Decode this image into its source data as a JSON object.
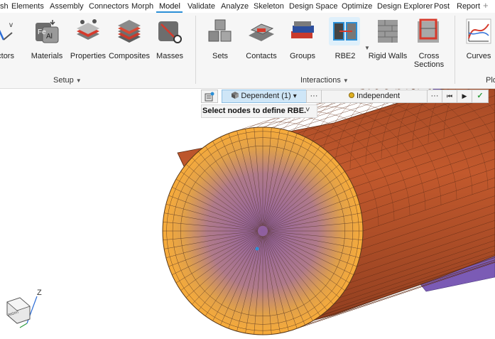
{
  "menu": {
    "items": [
      "sh",
      "Elements",
      "Assembly",
      "Connectors",
      "Morph",
      "Model",
      "Validate",
      "Analyze",
      "Skeleton",
      "Design Space",
      "Optimize",
      "Design Explorer",
      "Post",
      "Report"
    ],
    "active": "Model",
    "plus_glyph": "+"
  },
  "ribbon": {
    "setup_tools": [
      "ectors",
      "Materials",
      "Properties",
      "Composites",
      "Masses"
    ],
    "interaction_tools": [
      "Sets",
      "Contacts",
      "Groups",
      "RBE2",
      "Rigid Walls"
    ],
    "cross_sections": {
      "line1": "Cross",
      "line2": "Sections"
    },
    "curves": "Curves",
    "setup_label": "Setup",
    "interactions_label": "Interactions",
    "plot_label": "Plo",
    "caret": "▼",
    "materials_icon_text": {
      "fe": "Fe",
      "al": "Al"
    }
  },
  "toolbar": {
    "dependent": "Dependent (1)",
    "independent": "Independent",
    "more": "···",
    "dep_caret": "▾",
    "first_glyph": "⏮",
    "play_glyph": "▶",
    "check_glyph": "✓"
  },
  "hint": {
    "text": "Select nodes to define RBE.",
    "chevron": "˅"
  },
  "triad": {
    "z_label": "Z",
    "cube_label": "RIGHT"
  },
  "colors": {
    "accent": "#2b8fd6",
    "face": "#f8a93a",
    "cylinder": "#b8532b",
    "purple": "#7b5bb5",
    "dependent_bg": "#cfe6f7",
    "check": "#2e9c3e"
  }
}
